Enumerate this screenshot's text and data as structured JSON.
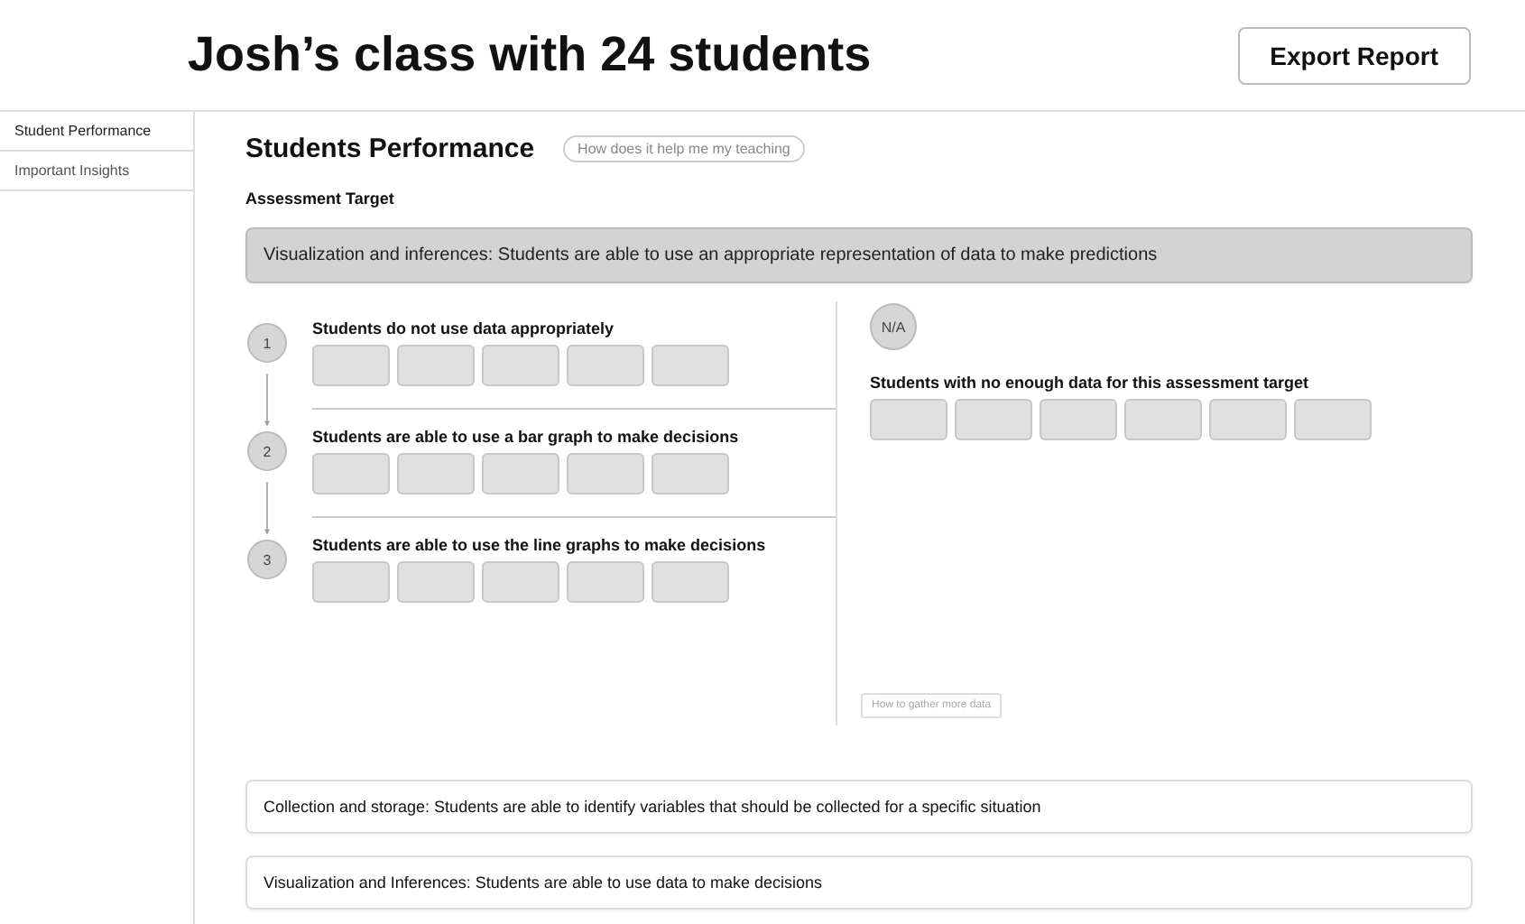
{
  "header": {
    "title": "Josh’s class with 24 students",
    "export_button": "Export Report"
  },
  "sidebar": {
    "items": [
      {
        "label": "Student Performance",
        "selected": true
      },
      {
        "label": "Important Insights",
        "selected": false
      }
    ]
  },
  "section": {
    "title": "Students Performance",
    "help_button": "How does it help me my teaching",
    "subtitle": "Assessment Target"
  },
  "targets": [
    {
      "label": "Visualization and inferences: Students are able to use an appropriate representation of data to make predictions",
      "expanded": true,
      "levels": [
        {
          "number": "1",
          "label": "Students do not use data appropriately",
          "students": [
            {
              "kind": "placeholder"
            },
            {
              "kind": "placeholder"
            },
            {
              "kind": "placeholder"
            },
            {
              "kind": "placeholder"
            },
            {
              "kind": "placeholder"
            }
          ]
        },
        {
          "number": "2",
          "label": "Students are able to use a bar graph to make decisions",
          "students": [
            {
              "kind": "placeholder"
            },
            {
              "kind": "placeholder"
            },
            {
              "kind": "placeholder"
            },
            {
              "kind": "placeholder"
            },
            {
              "kind": "placeholder"
            }
          ]
        },
        {
          "number": "3",
          "label": "Students are able to use the line graphs to make decisions",
          "students": [
            {
              "kind": "placeholder"
            },
            {
              "kind": "placeholder"
            },
            {
              "kind": "placeholder"
            },
            {
              "kind": "placeholder"
            },
            {
              "kind": "placeholder"
            }
          ]
        }
      ],
      "no_data": {
        "badge": "N/A",
        "label": "Students with no enough data for this assessment target",
        "students": [
          {
            "kind": "placeholder"
          },
          {
            "kind": "placeholder"
          },
          {
            "kind": "placeholder"
          },
          {
            "kind": "placeholder"
          },
          {
            "kind": "placeholder"
          },
          {
            "kind": "placeholder"
          }
        ],
        "help_button": "How to gather more data"
      }
    },
    {
      "label": "Collection and storage: Students are able to identify variables that should be collected for a specific situation",
      "expanded": false
    },
    {
      "label": "Visualization and Inferences: Students are able to use data to make decisions",
      "expanded": false
    }
  ]
}
